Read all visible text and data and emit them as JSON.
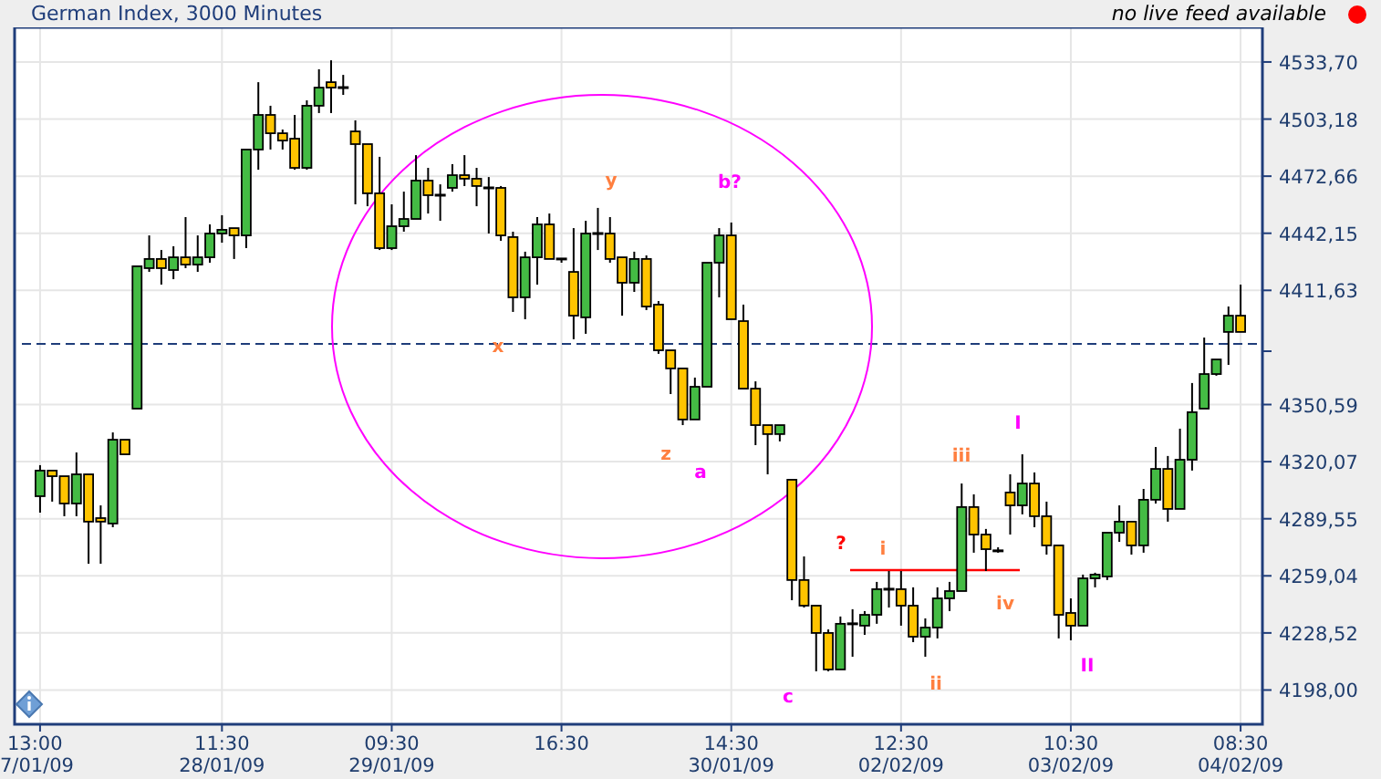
{
  "header": {
    "title": "German Index, 3000 Minutes",
    "feed_status": "no live feed available"
  },
  "price_chart": {
    "chart_data": {
      "type": "candlestick",
      "ylim": [
        4179.7,
        4552.2
      ],
      "grid": true,
      "categories": [
        "13:00\n7/01/09",
        null,
        null,
        null,
        null,
        null,
        null,
        null,
        null,
        null,
        null,
        null,
        null,
        null,
        null,
        "11:30\n28/01/09",
        null,
        null,
        null,
        null,
        null,
        null,
        null,
        null,
        null,
        null,
        null,
        null,
        null,
        "09:30\n29/01/09",
        null,
        null,
        null,
        null,
        null,
        null,
        null,
        null,
        null,
        null,
        null,
        null,
        null,
        "16:30",
        null,
        null,
        null,
        null,
        null,
        null,
        null,
        null,
        null,
        null,
        null,
        null,
        null,
        "14:30\n30/01/09",
        null,
        null,
        null,
        null,
        null,
        null,
        null,
        null,
        null,
        null,
        null,
        null,
        null,
        "12:30\n02/02/09",
        null,
        null,
        null,
        null,
        null,
        null,
        null,
        null,
        null,
        null,
        null,
        null,
        null,
        "10:30\n03/02/09",
        null,
        null,
        null,
        null,
        null,
        null,
        null,
        null,
        null,
        null,
        null,
        null,
        null,
        "08:30\n04/02/09"
      ],
      "yticks": [
        {
          "value": 4533.7,
          "label": "4533,70"
        },
        {
          "value": 4503.18,
          "label": "4503,18"
        },
        {
          "value": 4472.66,
          "label": "4472,66"
        },
        {
          "value": 4442.15,
          "label": "4442,15"
        },
        {
          "value": 4411.63,
          "label": "4411,63"
        },
        {
          "value": 4350.59,
          "label": "4350,59"
        },
        {
          "value": 4320.07,
          "label": "4320,07"
        },
        {
          "value": 4289.55,
          "label": "4289,55"
        },
        {
          "value": 4259.04,
          "label": "4259,04"
        },
        {
          "value": 4228.52,
          "label": "4228,52"
        },
        {
          "value": 4198.0,
          "label": "4198,00"
        }
      ],
      "ref_lines": [
        {
          "axis": "y",
          "value": 4383.0
        }
      ],
      "ohlc": [
        [
          4301.6,
          4318.2,
          4292.8,
          4315.3
        ],
        [
          4315.3,
          4315.3,
          4298.7,
          4312.3
        ],
        [
          4312.3,
          4312.3,
          4290.9,
          4297.7
        ],
        [
          4297.7,
          4325.0,
          4290.9,
          4313.3
        ],
        [
          4313.3,
          4313.3,
          4265.5,
          4288.0
        ],
        [
          4289.9,
          4296.7,
          4265.5,
          4288.0
        ],
        [
          4287.0,
          4335.7,
          4285.0,
          4331.8
        ],
        [
          4331.8,
          4331.8,
          4324.0,
          4324.0
        ],
        [
          4348.4,
          4424.5,
          4348.4,
          4424.5
        ],
        [
          4423.5,
          4441.0,
          4421.5,
          4428.4
        ],
        [
          4428.4,
          4433.2,
          4414.7,
          4423.5
        ],
        [
          4422.5,
          4435.2,
          4417.6,
          4429.3
        ],
        [
          4429.3,
          4450.8,
          4423.5,
          4425.4
        ],
        [
          4425.4,
          4441.0,
          4421.5,
          4429.3
        ],
        [
          4429.3,
          4446.9,
          4426.4,
          4442.0
        ],
        [
          4442.0,
          4451.8,
          4437.1,
          4444.0
        ],
        [
          4444.9,
          4444.9,
          4428.4,
          4441.0
        ],
        [
          4441.0,
          4486.9,
          4434.2,
          4486.9
        ],
        [
          4486.9,
          4522.9,
          4476.1,
          4505.4
        ],
        [
          4505.4,
          4510.3,
          4486.9,
          4495.6
        ],
        [
          4495.6,
          4497.6,
          4486.9,
          4491.7
        ],
        [
          4492.7,
          4505.4,
          4476.1,
          4477.1
        ],
        [
          4477.1,
          4513.2,
          4476.1,
          4510.3
        ],
        [
          4510.3,
          4529.8,
          4506.4,
          4520.0
        ],
        [
          4522.9,
          4534.6,
          4506.4,
          4520.0
        ],
        [
          4520.0,
          4526.8,
          4516.1,
          4520.0
        ],
        [
          4496.6,
          4502.5,
          4457.6,
          4489.8
        ],
        [
          4489.8,
          4489.8,
          4456.6,
          4463.5
        ],
        [
          4463.5,
          4483.0,
          4433.2,
          4434.2
        ],
        [
          4434.2,
          4457.6,
          4433.2,
          4445.9
        ],
        [
          4445.9,
          4464.4,
          4443.0,
          4449.8
        ],
        [
          4449.8,
          4483.9,
          4449.8,
          4470.3
        ],
        [
          4470.3,
          4477.1,
          4452.7,
          4462.5
        ],
        [
          4462.5,
          4468.3,
          4448.8,
          4462.5
        ],
        [
          4466.4,
          4479.1,
          4464.4,
          4473.2
        ],
        [
          4473.2,
          4483.9,
          4467.4,
          4471.3
        ],
        [
          4471.3,
          4477.1,
          4456.6,
          4467.4
        ],
        [
          4466.4,
          4472.2,
          4442.0,
          4466.4
        ],
        [
          4466.4,
          4467.4,
          4438.1,
          4441.0
        ],
        [
          4440.1,
          4443.0,
          4400.1,
          4407.9
        ],
        [
          4407.9,
          4432.3,
          4396.2,
          4429.3
        ],
        [
          4429.3,
          4450.8,
          4414.7,
          4446.9
        ],
        [
          4446.9,
          4452.7,
          4428.4,
          4428.4
        ],
        [
          4428.4,
          4428.4,
          4426.4,
          4428.4
        ],
        [
          4421.5,
          4444.9,
          4385.5,
          4398.1
        ],
        [
          4397.2,
          4448.8,
          4388.4,
          4442.0
        ],
        [
          4442.0,
          4455.7,
          4433.2,
          4442.0
        ],
        [
          4442.0,
          4450.8,
          4426.4,
          4428.4
        ],
        [
          4429.3,
          4429.3,
          4398.1,
          4415.7
        ],
        [
          4415.7,
          4432.3,
          4410.8,
          4428.4
        ],
        [
          4428.4,
          4430.3,
          4401.1,
          4403.0
        ],
        [
          4404.0,
          4405.9,
          4377.7,
          4379.6
        ],
        [
          4379.6,
          4379.6,
          4356.2,
          4369.9
        ],
        [
          4369.9,
          4369.9,
          4339.6,
          4342.6
        ],
        [
          4342.6,
          4365.0,
          4342.6,
          4360.1
        ],
        [
          4360.1,
          4426.4,
          4360.1,
          4426.4
        ],
        [
          4426.4,
          4444.9,
          4407.9,
          4441.0
        ],
        [
          4441.0,
          4447.9,
          4396.2,
          4396.2
        ],
        [
          4395.2,
          4404.0,
          4359.1,
          4359.1
        ],
        [
          4359.1,
          4363.0,
          4328.9,
          4339.6
        ],
        [
          4339.6,
          4339.6,
          4313.3,
          4334.8
        ],
        [
          4334.8,
          4339.6,
          4330.9,
          4339.6
        ],
        [
          4310.4,
          4310.4,
          4246.0,
          4256.8
        ],
        [
          4256.8,
          4269.4,
          4242.1,
          4243.1
        ],
        [
          4243.1,
          4243.1,
          4208.0,
          4228.5
        ],
        [
          4228.5,
          4230.4,
          4208.0,
          4209.0
        ],
        [
          4209.0,
          4237.3,
          4209.0,
          4233.4
        ],
        [
          4233.4,
          4241.2,
          4215.8,
          4233.4
        ],
        [
          4232.4,
          4240.2,
          4227.5,
          4238.2
        ],
        [
          4238.2,
          4255.8,
          4233.4,
          4251.9
        ],
        [
          4251.9,
          4261.6,
          4242.1,
          4251.9
        ],
        [
          4251.9,
          4261.6,
          4232.4,
          4243.1
        ],
        [
          4243.1,
          4252.9,
          4223.6,
          4226.5
        ],
        [
          4226.5,
          4236.3,
          4215.8,
          4231.4
        ],
        [
          4231.4,
          4252.9,
          4225.6,
          4247.0
        ],
        [
          4247.0,
          4255.8,
          4240.2,
          4250.9
        ],
        [
          4250.9,
          4308.4,
          4250.9,
          4295.8
        ],
        [
          4295.8,
          4302.6,
          4271.4,
          4281.1
        ],
        [
          4281.1,
          4284.1,
          4261.6,
          4273.3
        ],
        [
          4272.4,
          4274.3,
          4271.4,
          4272.4
        ],
        [
          4303.6,
          4313.3,
          4281.1,
          4296.7
        ],
        [
          4296.7,
          4324.0,
          4291.9,
          4308.4
        ],
        [
          4308.4,
          4314.3,
          4285.0,
          4290.9
        ],
        [
          4290.9,
          4298.7,
          4270.4,
          4275.3
        ],
        [
          4275.3,
          4275.3,
          4225.6,
          4238.2
        ],
        [
          4239.2,
          4247.0,
          4224.6,
          4232.4
        ],
        [
          4232.4,
          4259.7,
          4232.4,
          4257.7
        ],
        [
          4257.7,
          4260.7,
          4252.9,
          4259.7
        ],
        [
          4258.7,
          4282.1,
          4256.8,
          4282.1
        ],
        [
          4282.1,
          4296.7,
          4277.2,
          4288.0
        ],
        [
          4288.0,
          4288.0,
          4270.4,
          4275.3
        ],
        [
          4275.3,
          4305.5,
          4271.4,
          4299.7
        ],
        [
          4299.7,
          4327.9,
          4297.7,
          4316.2
        ],
        [
          4316.2,
          4323.1,
          4288.0,
          4294.8
        ],
        [
          4294.8,
          4337.7,
          4294.8,
          4321.1
        ],
        [
          4321.1,
          4362.1,
          4315.3,
          4346.5
        ],
        [
          4348.4,
          4386.4,
          4348.4,
          4366.9
        ],
        [
          4366.9,
          4374.7,
          4366.0,
          4374.7
        ],
        [
          4389.4,
          4403.0,
          4371.8,
          4398.1
        ],
        [
          4398.1,
          4414.7,
          4389.4,
          4389.4
        ]
      ]
    },
    "annotations": [
      {
        "text": "x",
        "color": "#ff7f3f"
      },
      {
        "text": "y",
        "color": "#ff7f3f"
      },
      {
        "text": "z",
        "color": "#ff7f3f"
      },
      {
        "text": "a",
        "color": "#ff00ff"
      },
      {
        "text": "b?",
        "color": "#ff00ff"
      },
      {
        "text": "c",
        "color": "#ff00ff"
      },
      {
        "text": "?",
        "color": "#ff0000"
      },
      {
        "text": "i",
        "color": "#ff7f3f"
      },
      {
        "text": "ii",
        "color": "#ff7f3f"
      },
      {
        "text": "iii",
        "color": "#ff7f3f"
      },
      {
        "text": "iv",
        "color": "#ff7f3f"
      },
      {
        "text": "I",
        "color": "#ff00ff"
      },
      {
        "text": "II",
        "color": "#ff00ff"
      }
    ]
  }
}
